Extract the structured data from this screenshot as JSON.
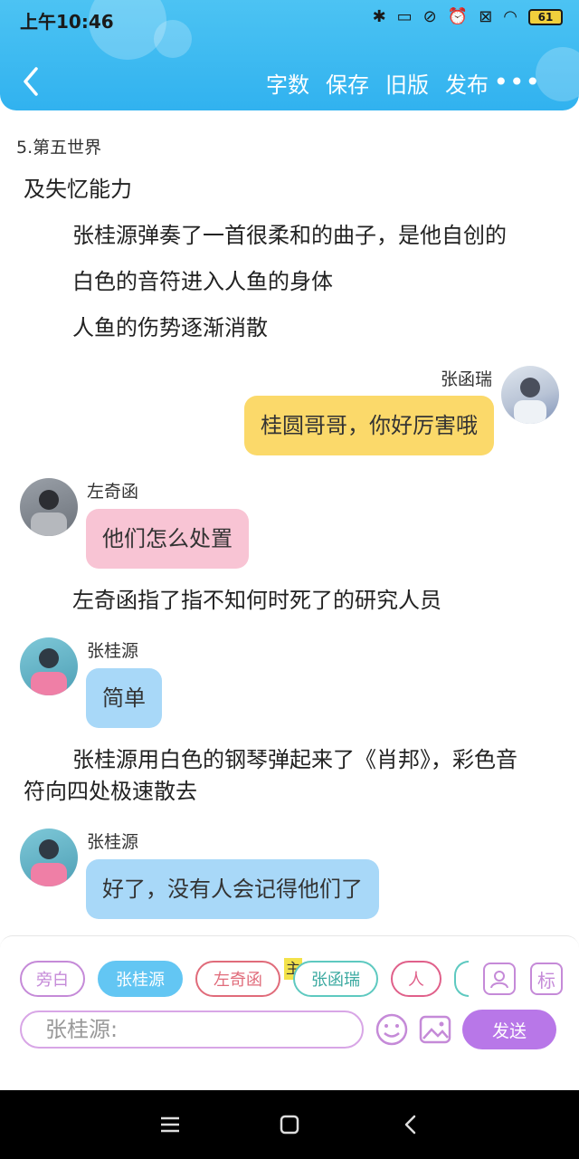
{
  "status": {
    "time": "上午10:46",
    "battery": "61"
  },
  "navbar": {
    "actions": [
      "字数",
      "保存",
      "旧版",
      "发布"
    ],
    "more": "•••"
  },
  "chapter_title": "5.第五世界",
  "paragraphs": {
    "p1": "及失忆能力",
    "p2": "张桂源弹奏了一首很柔和的曲子，是他自创的",
    "p3": "白色的音符进入人鱼的身体",
    "p4": "人鱼的伤势逐渐消散",
    "p5": "左奇函指了指不知何时死了的研究人员",
    "p6a": "张桂源用白色的钢琴弹起来了《肖邦》，彩色音",
    "p6b": "符向四处极速散去"
  },
  "messages": [
    {
      "name": "张函瑞",
      "text": "桂圆哥哥，你好厉害哦",
      "color": "#fbd96a"
    },
    {
      "name": "左奇函",
      "text": "他们怎么处置",
      "color": "#f8c4d4"
    },
    {
      "name": "张桂源",
      "text": "简单",
      "color": "#a8d8f8"
    },
    {
      "name": "张桂源",
      "text": "好了，没有人会记得他们了",
      "color": "#a8d8f8"
    }
  ],
  "roles": [
    {
      "label": "旁白",
      "border": "#c58ad8",
      "text": "#c58ad8",
      "bg": "#ffffff"
    },
    {
      "label": "张桂源",
      "border": "#63c6f3",
      "text": "#ffffff",
      "bg": "#63c6f3"
    },
    {
      "label": "左奇函",
      "border": "#e06b7a",
      "text": "#e06b7a",
      "bg": "#ffffff"
    },
    {
      "label": "张函瑞",
      "border": "#5ec9c0",
      "text": "#3aa9a0",
      "bg": "#ffffff"
    },
    {
      "label": "人",
      "border": "#e0608a",
      "text": "#e0608a",
      "bg": "#ffffff"
    }
  ],
  "main_badge": "主",
  "input": {
    "placeholder": "张桂源:"
  },
  "send_label": "发送",
  "tools": {
    "role_icon": "person-card-icon",
    "mark_label": "标"
  }
}
